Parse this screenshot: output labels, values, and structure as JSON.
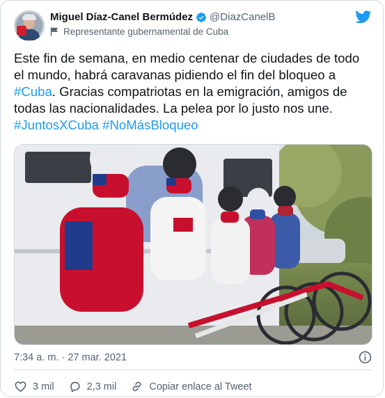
{
  "author": {
    "name": "Miguel Díaz-Canel Bermúdez",
    "handle": "@DiazCanelB",
    "label": "Representante gubernamental de Cuba"
  },
  "tweet": {
    "text_parts": [
      "Este fin de semana, en medio centenar de ciudades de todo el mundo, habrá caravanas pidiendo el fin del bloqueo a ",
      "#Cuba",
      ". Gracias compatriotas en la emigración, amigos de todas las nacionalidades. La pelea por lo justo nos une. ",
      "#JuntosXCuba",
      " ",
      "#NoMásBloqueo"
    ]
  },
  "timestamp": "7:34 a. m. · 27 mar. 2021",
  "actions": {
    "likes": "3 mil",
    "replies": "2,3 mil",
    "copy_link": "Copiar enlace al Tweet"
  },
  "colors": {
    "accent": "#1d9bf0",
    "muted": "#536471",
    "border": "#cfd9de"
  }
}
